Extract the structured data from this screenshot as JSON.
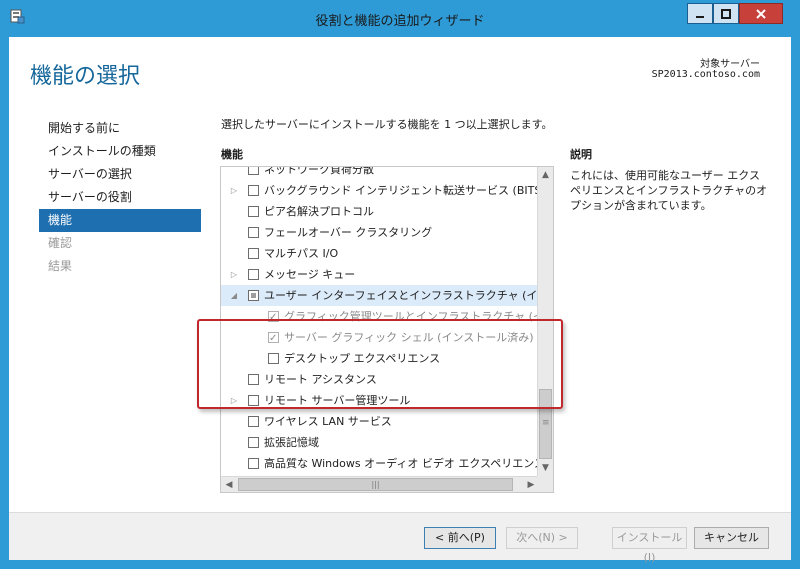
{
  "window": {
    "title": "役割と機能の追加ウィザード",
    "minimize": "_",
    "maximize": "□",
    "close": "X"
  },
  "page": {
    "title": "機能の選択",
    "target_label": "対象サーバー",
    "target_host": "SP2013.contoso.com"
  },
  "nav": [
    {
      "label": "開始する前に",
      "state": "normal"
    },
    {
      "label": "インストールの種類",
      "state": "normal"
    },
    {
      "label": "サーバーの選択",
      "state": "normal"
    },
    {
      "label": "サーバーの役割",
      "state": "normal"
    },
    {
      "label": "機能",
      "state": "active"
    },
    {
      "label": "確認",
      "state": "disabled"
    },
    {
      "label": "結果",
      "state": "disabled"
    }
  ],
  "main": {
    "instruction": "選択したサーバーにインストールする機能を 1 つ以上選択します。",
    "features_heading": "機能",
    "description_heading": "説明",
    "description_text": "これには、使用可能なユーザー エクスペリエンスとインフラストラクチャのオプションが含まれています。"
  },
  "features": [
    {
      "label": "ネットワーク負荷分散",
      "expander": "none",
      "check": "unchecked",
      "level": 0
    },
    {
      "label": "バックグラウンド インテリジェント転送サービス (BITS)",
      "expander": "collapsed",
      "check": "unchecked",
      "level": 0
    },
    {
      "label": "ピア名解決プロトコル",
      "expander": "none",
      "check": "unchecked",
      "level": 0
    },
    {
      "label": "フェールオーバー クラスタリング",
      "expander": "none",
      "check": "unchecked",
      "level": 0
    },
    {
      "label": "マルチパス I/O",
      "expander": "none",
      "check": "unchecked",
      "level": 0
    },
    {
      "label": "メッセージ キュー",
      "expander": "collapsed",
      "check": "unchecked",
      "level": 0
    },
    {
      "label": "ユーザー インターフェイスとインフラストラクチャ (インストール済み)",
      "expander": "expanded",
      "check": "partial",
      "level": 0,
      "highlight": true
    },
    {
      "label": "グラフィック管理ツールとインフラストラクチャ (インストール済み)",
      "expander": "none",
      "check": "checked",
      "level": 1,
      "dim": true
    },
    {
      "label": "サーバー グラフィック シェル (インストール済み)",
      "expander": "none",
      "check": "checked",
      "level": 1,
      "dim": true
    },
    {
      "label": "デスクトップ エクスペリエンス",
      "expander": "none",
      "check": "unchecked",
      "level": 1
    },
    {
      "label": "リモート アシスタンス",
      "expander": "none",
      "check": "unchecked",
      "level": 0
    },
    {
      "label": "リモート サーバー管理ツール",
      "expander": "collapsed",
      "check": "unchecked",
      "level": 0
    },
    {
      "label": "ワイヤレス LAN サービス",
      "expander": "none",
      "check": "unchecked",
      "level": 0
    },
    {
      "label": "拡張記憶域",
      "expander": "none",
      "check": "unchecked",
      "level": 0
    },
    {
      "label": "高品質な Windows オーディオ ビデオ エクスペリエンス",
      "expander": "none",
      "check": "unchecked",
      "level": 0
    }
  ],
  "buttons": {
    "prev": "< 前へ(P)",
    "next": "次へ(N) >",
    "install": "インストール(I)",
    "cancel": "キャンセル"
  },
  "colors": {
    "title_blue": "#16679b",
    "nav_active": "#1e6fb0",
    "callout_red": "#c0282b",
    "frame_blue": "#2e9bd6"
  }
}
